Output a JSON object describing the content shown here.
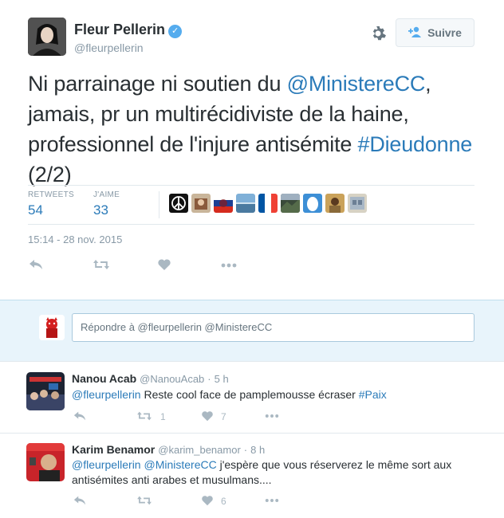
{
  "tweet": {
    "author_name": "Fleur Pellerin",
    "author_handle": "@fleurpellerin",
    "follow_label": "Suivre",
    "text_part1": "Ni parrainage ni soutien du ",
    "mention": "@MinistereCC",
    "text_part2": ", jamais, pr un multirécidiviste de la haine, professionnel de l'injure antisémite ",
    "hashtag": "#Dieudonne",
    "text_part3": " (2/2)",
    "retweets_label": "RETWEETS",
    "retweets_count": "54",
    "likes_label": "J'AIME",
    "likes_count": "33",
    "timestamp": "15:14 - 28 nov. 2015"
  },
  "reply_box": {
    "placeholder": "Répondre à @fleurpellerin @MinistereCC"
  },
  "replies": [
    {
      "name": "Nanou Acab",
      "handle": "@NanouAcab",
      "time": "5 h",
      "mention": "@fleurpellerin",
      "text": " Reste cool face de pamplemousse écraser ",
      "hashtag": "#Paix",
      "retweets": "1",
      "likes": "7"
    },
    {
      "name": "Karim Benamor",
      "handle": "@karim_benamor",
      "time": "8 h",
      "mention1": "@fleurpellerin",
      "mention2": "@MinistereCC",
      "text": " j'espère que vous réserverez le même sort aux antisémites anti arabes et musulmans....",
      "retweets": "",
      "likes": "6"
    }
  ],
  "colors": {
    "link": "#2b7bb9",
    "muted": "#8899a6",
    "icon": "#aab8c2",
    "reply_bg": "#e8f4fb"
  },
  "icons": [
    "verified-badge-icon",
    "gear-icon",
    "follow-person-icon",
    "reply-icon",
    "retweet-icon",
    "heart-icon",
    "more-icon"
  ]
}
